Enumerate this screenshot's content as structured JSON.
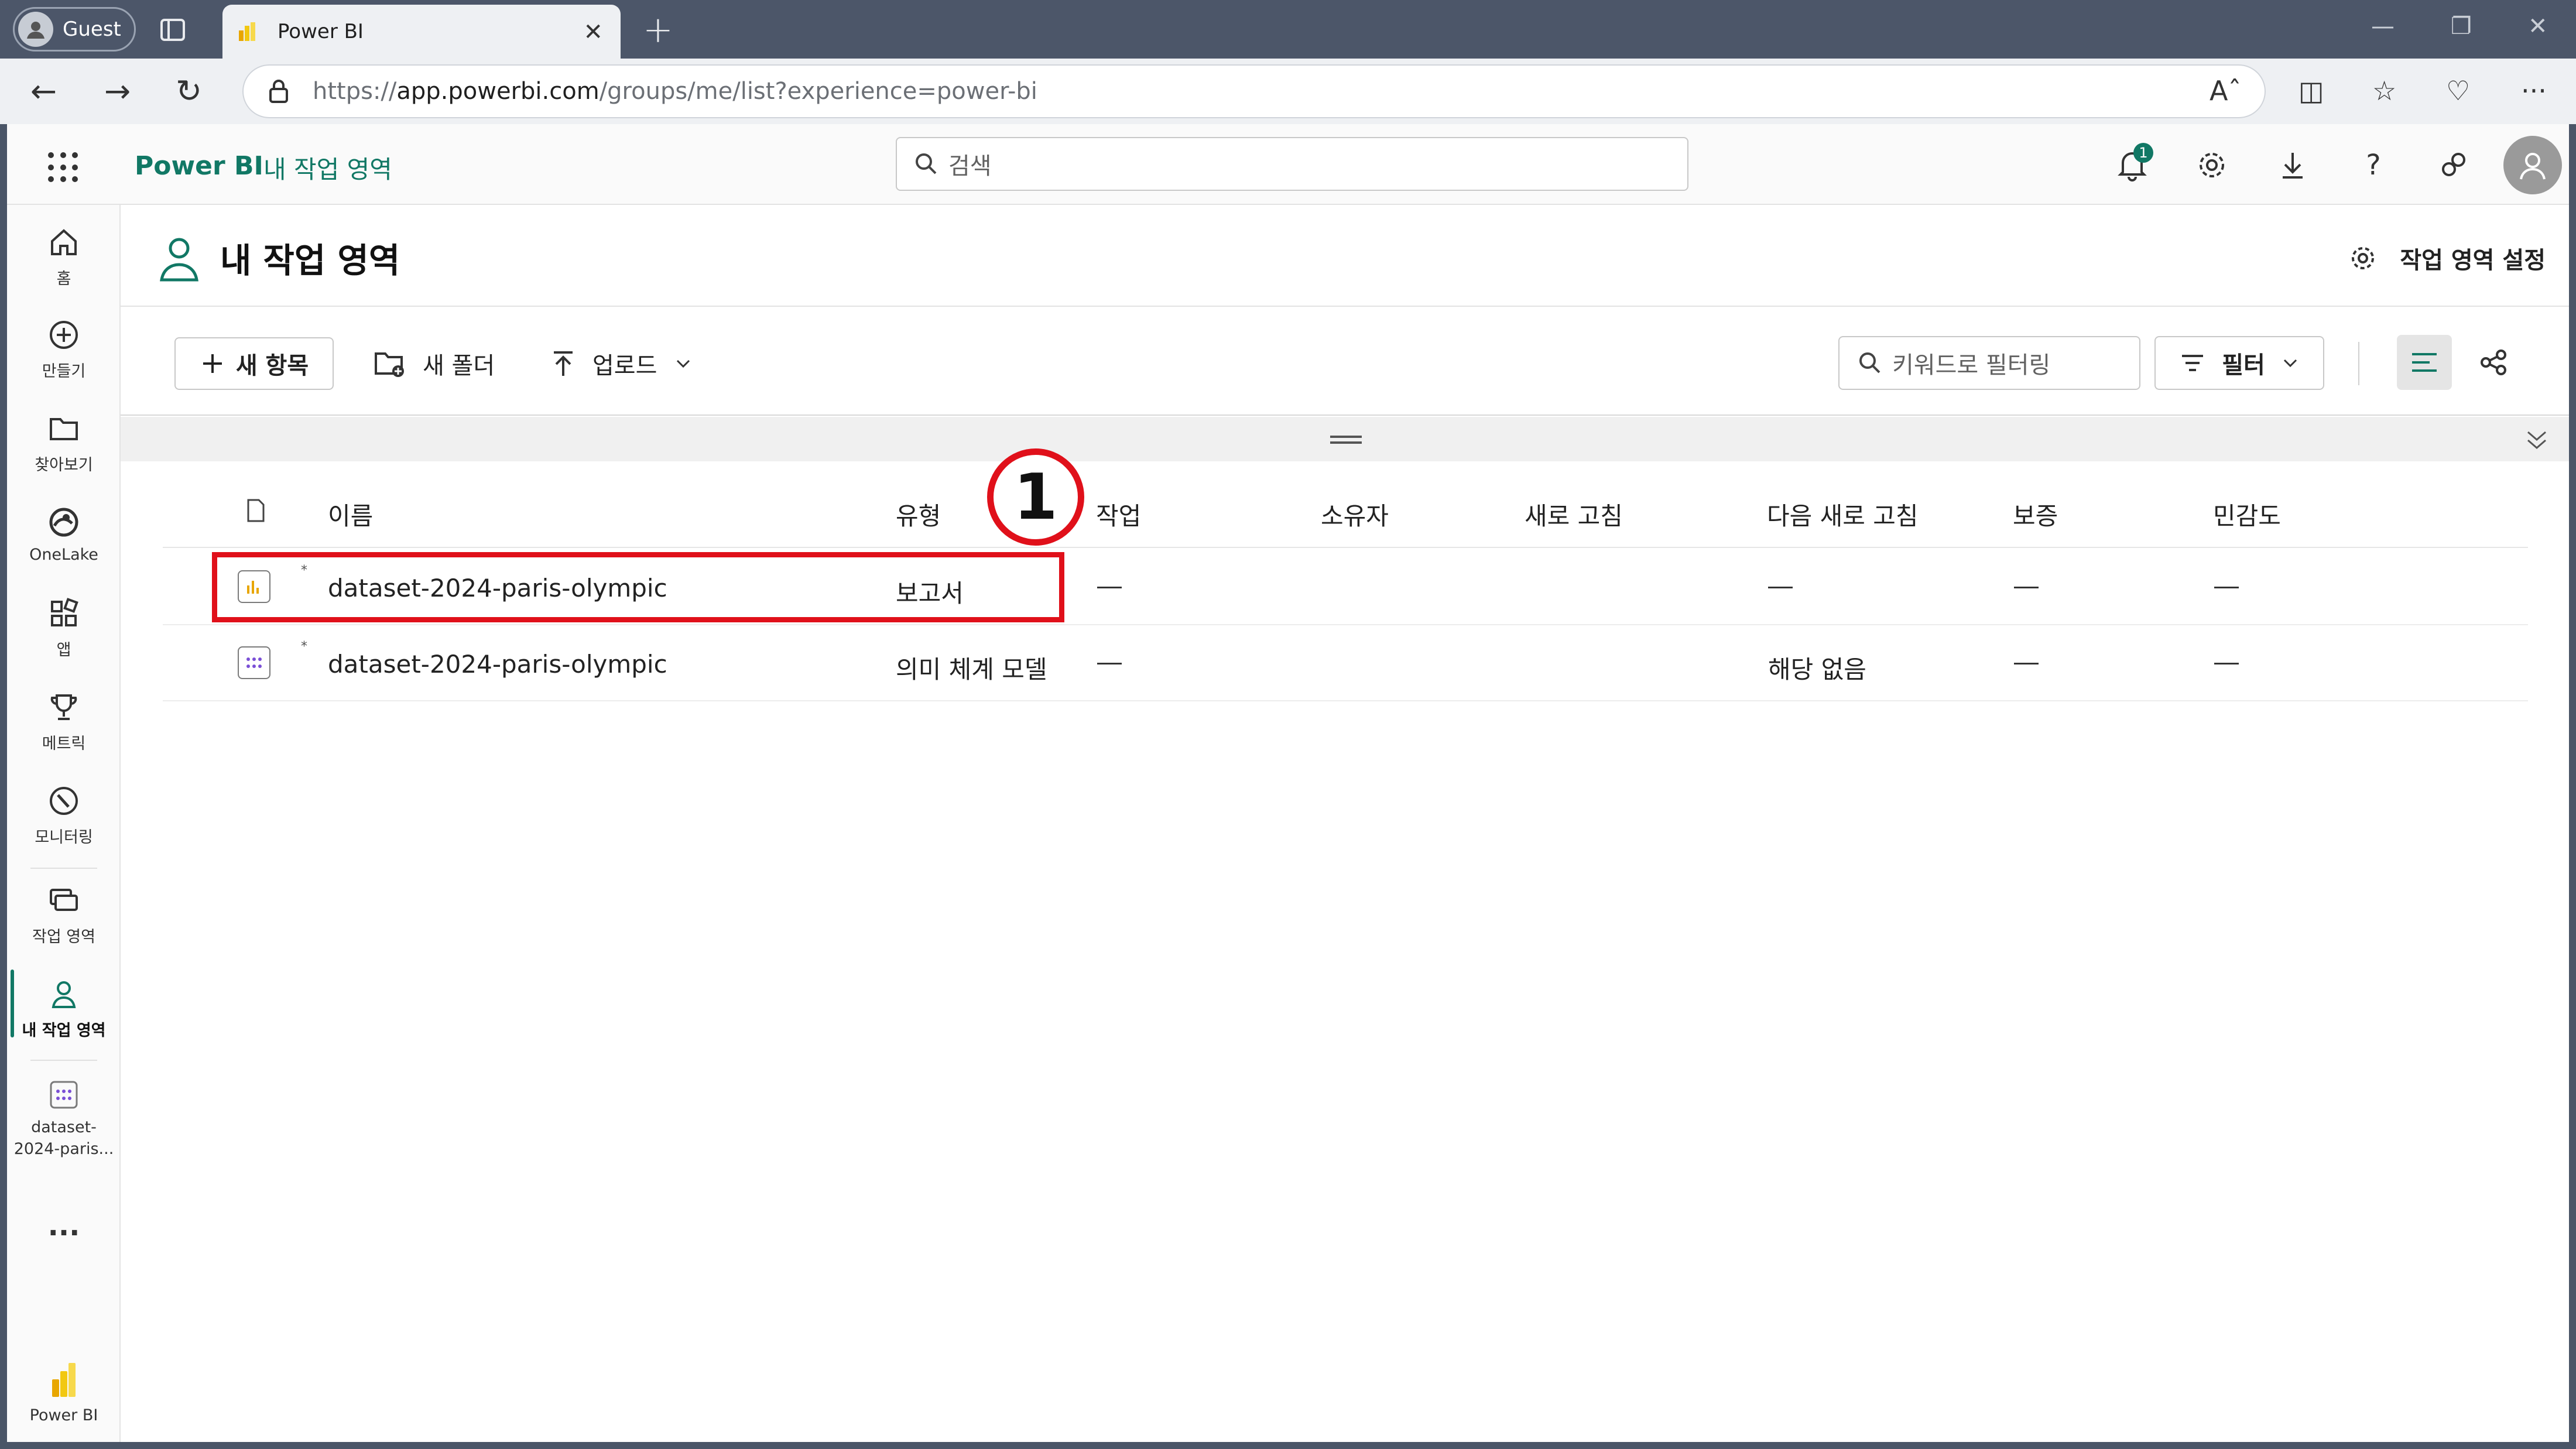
{
  "browser": {
    "profile_label": "Guest",
    "tab_title": "Power BI",
    "url_scheme": "https://",
    "url_host": "app.powerbi.com",
    "url_path": "/groups/me/list?experience=power-bi"
  },
  "header": {
    "brand": "Power BI",
    "workspace_link": "내 작업 영역",
    "search_placeholder": "검색",
    "notification_count": "1"
  },
  "leftnav": {
    "items": [
      {
        "label": "홈",
        "icon": "home-icon"
      },
      {
        "label": "만들기",
        "icon": "create-icon"
      },
      {
        "label": "찾아보기",
        "icon": "browse-icon"
      },
      {
        "label": "OneLake",
        "icon": "onelake-icon"
      },
      {
        "label": "앱",
        "icon": "apps-icon"
      },
      {
        "label": "메트릭",
        "icon": "trophy-icon"
      },
      {
        "label": "모니터링",
        "icon": "monitor-icon"
      },
      {
        "label": "작업 영역",
        "icon": "workspaces-icon"
      },
      {
        "label": "내 작업 영역",
        "icon": "person-icon"
      },
      {
        "label": "dataset-",
        "icon": "semantic-model-icon"
      },
      {
        "label": "2024-paris...",
        "icon": ""
      }
    ],
    "more": "...",
    "bottom_label": "Power BI"
  },
  "page": {
    "title": "내 작업 영역",
    "settings_label": "작업 영역 설정"
  },
  "toolbar": {
    "new_item": "새 항목",
    "new_folder": "새 폴더",
    "upload": "업로드",
    "filter_placeholder": "키워드로 필터링",
    "filter_label": "필터"
  },
  "table": {
    "columns": [
      "이름",
      "유형",
      "작업",
      "소유자",
      "새로 고침",
      "다음 새로 고침",
      "보증",
      "민감도"
    ],
    "rows": [
      {
        "name": "dataset-2024-paris-olympic",
        "type": "보고서",
        "task": "—",
        "owner": "",
        "refresh": "",
        "next_refresh": "—",
        "endorsement": "—",
        "sensitivity": "—",
        "icon": "report-icon"
      },
      {
        "name": "dataset-2024-paris-olympic",
        "type": "의미 체계 모델",
        "task": "—",
        "owner": "",
        "refresh": "",
        "next_refresh": "해당 없음",
        "endorsement": "—",
        "sensitivity": "—",
        "icon": "semantic-model-icon"
      }
    ]
  },
  "annotation": {
    "step_number": "1"
  },
  "colors": {
    "brand": "#117865",
    "highlight": "#e0101a",
    "powerbi_yellow": "#f2c811"
  }
}
